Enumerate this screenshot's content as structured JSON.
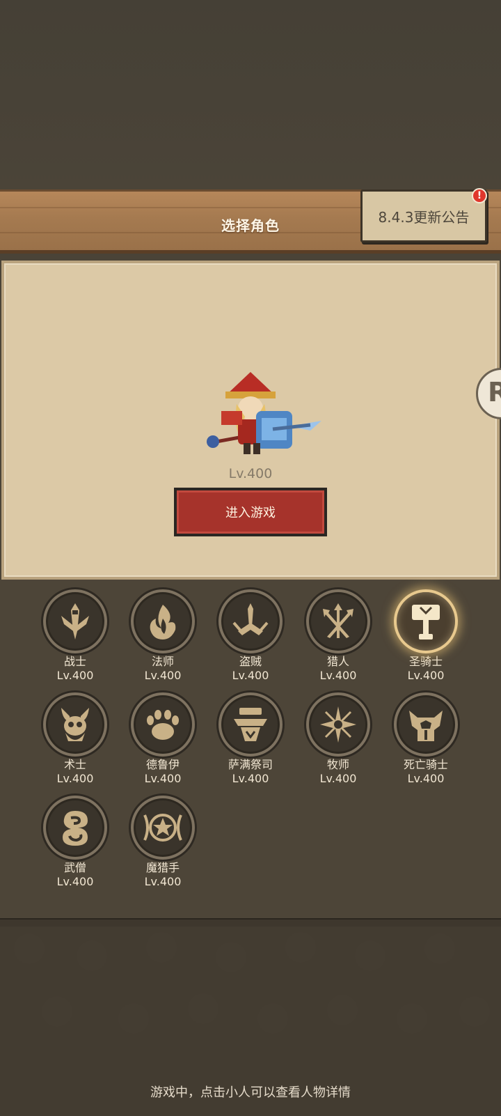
{
  "header": {
    "title": "选择角色",
    "notice_label": "8.4.3更新公告",
    "notice_badge": "!"
  },
  "hero": {
    "level": "Lv.400",
    "enter_label": "进入游戏"
  },
  "side_tab": {
    "glyph": "R"
  },
  "classes": [
    {
      "name": "战士",
      "level": "Lv.400",
      "icon": "sword-icon",
      "selected": false
    },
    {
      "name": "法师",
      "level": "Lv.400",
      "icon": "flame-icon",
      "selected": false
    },
    {
      "name": "盗贼",
      "level": "Lv.400",
      "icon": "dagger-icon",
      "selected": false
    },
    {
      "name": "猎人",
      "level": "Lv.400",
      "icon": "arrows-icon",
      "selected": false
    },
    {
      "name": "圣骑士",
      "level": "Lv.400",
      "icon": "hammer-icon",
      "selected": true
    },
    {
      "name": "术士",
      "level": "Lv.400",
      "icon": "horned-skull-icon",
      "selected": false
    },
    {
      "name": "德鲁伊",
      "level": "Lv.400",
      "icon": "paw-icon",
      "selected": false
    },
    {
      "name": "萨满祭司",
      "level": "Lv.400",
      "icon": "totem-icon",
      "selected": false
    },
    {
      "name": "牧师",
      "level": "Lv.400",
      "icon": "star-burst-icon",
      "selected": false
    },
    {
      "name": "死亡骑士",
      "level": "Lv.400",
      "icon": "death-helm-icon",
      "selected": false
    },
    {
      "name": "武僧",
      "level": "Lv.400",
      "icon": "swirl-icon",
      "selected": false
    },
    {
      "name": "魔猎手",
      "level": "Lv.400",
      "icon": "demon-star-icon",
      "selected": false
    }
  ],
  "footer": {
    "hint": "游戏中，点击小人可以查看人物详情"
  },
  "colors": {
    "accent": "#a6332b",
    "selected_glow": "#e8c98e",
    "icon_gold": "#c9b187"
  }
}
